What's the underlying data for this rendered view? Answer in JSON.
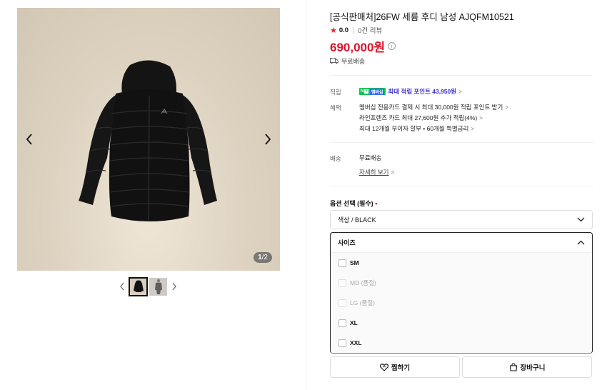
{
  "gallery": {
    "counter_current": "1",
    "counter_total": "/2",
    "prev_icon": "chevron-left-icon",
    "next_icon": "chevron-right-icon"
  },
  "product": {
    "title": "[공식판매처]26FW 세륨 후디 남성 AJQFM10521",
    "rating": "0.0",
    "reviews": "0건 리뷰",
    "price": "690,000원",
    "shipping_top": "무료배송"
  },
  "benefits": {
    "points_label": "적립",
    "npay_n": "N",
    "npay_plus": "+",
    "npay_member": "멤버십",
    "points_text": "최대 적립 포인트 43,950원",
    "perks_label": "혜택",
    "perks": [
      "멤버십 전용카드 결제 시 최대 30,000원 적립 포인트 받기",
      "라인프렌즈 카드 최대 27,600원 추가 적립(4%)",
      "최대 12개월 무이자 할부 • 60개월 특별금리"
    ]
  },
  "delivery": {
    "label": "배송",
    "value": "무료배송",
    "detail_link": "자세히 보기"
  },
  "options": {
    "title": "옵션 선택 (필수)",
    "required_mark": "•",
    "color_value": "색상 / BLACK",
    "size_label": "사이즈",
    "sizes": [
      {
        "label": "SM",
        "disabled": false
      },
      {
        "label": "MD (품절)",
        "disabled": true
      },
      {
        "label": "LG (품절)",
        "disabled": true
      },
      {
        "label": "XL",
        "disabled": false
      },
      {
        "label": "XXL",
        "disabled": false
      }
    ]
  },
  "actions": {
    "wish_label": "찜하기",
    "cart_label": "장바구니"
  },
  "colors": {
    "price": "#e0122b",
    "points": "#3a2fd6",
    "npay_green": "#06c755",
    "dropdown_focus": "#3aa655"
  }
}
